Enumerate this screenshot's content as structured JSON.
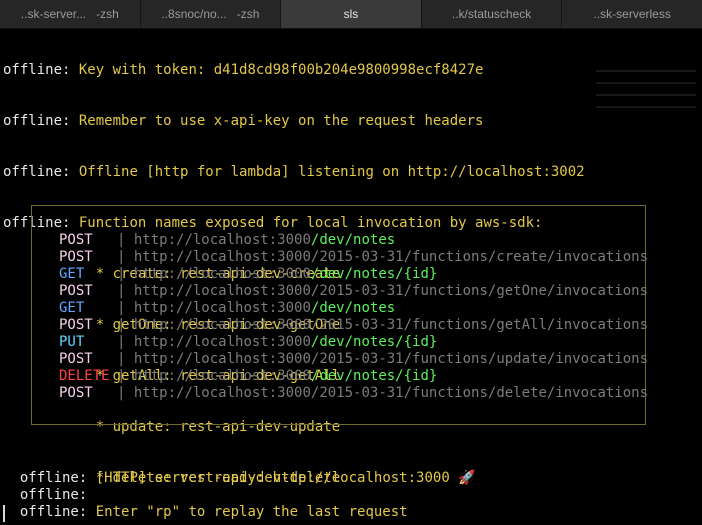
{
  "tabs": [
    {
      "main": "..sk-server...",
      "sub": "-zsh"
    },
    {
      "main": "..8snoc/no...",
      "sub": "-zsh"
    },
    {
      "main": "sls",
      "sub": ""
    },
    {
      "main": "..k/statuscheck",
      "sub": ""
    },
    {
      "main": "..sk-serverless",
      "sub": ""
    }
  ],
  "prefix": "offline:",
  "log_top": [
    "Key with token: d41d8cd98f00b204e9800998ecf8427e",
    "Remember to use x-api-key on the request headers",
    "Offline [http for lambda] listening on http://localhost:3002",
    "Function names exposed for local invocation by aws-sdk:"
  ],
  "functions": [
    "* create: rest-api-dev-create",
    "* getOne: rest-api-dev-getOne",
    "* getAll: rest-api-dev-getAll",
    "* update: rest-api-dev-update",
    "* delete: rest-api-dev-delete"
  ],
  "routes": [
    {
      "method": "POST",
      "base": "http://localhost:3000",
      "path": "/dev/notes",
      "path_style": "green"
    },
    {
      "method": "POST",
      "base": "http://localhost:3000",
      "path": "/2015-03-31/functions/create/invocations",
      "path_style": "grey"
    },
    {
      "method": "GET",
      "base": "http://localhost:3000",
      "path": "/dev/notes/{id}",
      "path_style": "green"
    },
    {
      "method": "POST",
      "base": "http://localhost:3000",
      "path": "/2015-03-31/functions/getOne/invocations",
      "path_style": "grey"
    },
    {
      "method": "GET",
      "base": "http://localhost:3000",
      "path": "/dev/notes",
      "path_style": "green"
    },
    {
      "method": "POST",
      "base": "http://localhost:3000",
      "path": "/2015-03-31/functions/getAll/invocations",
      "path_style": "grey"
    },
    {
      "method": "PUT",
      "base": "http://localhost:3000",
      "path": "/dev/notes/{id}",
      "path_style": "green"
    },
    {
      "method": "POST",
      "base": "http://localhost:3000",
      "path": "/2015-03-31/functions/update/invocations",
      "path_style": "grey"
    },
    {
      "method": "DELETE",
      "base": "http://localhost:3000",
      "path": "/dev/notes/{id}",
      "path_style": "green"
    },
    {
      "method": "POST",
      "base": "http://localhost:3000",
      "path": "/2015-03-31/functions/delete/invocations",
      "path_style": "grey"
    }
  ],
  "route_separator": "|",
  "server_ready": {
    "tag": "[HTTP]",
    "text": "server ready: http://localhost:3000",
    "emoji": "🚀"
  },
  "replay_hint": "Enter \"rp\" to replay the last request",
  "colors": {
    "POST": "#f3cfe8",
    "GET": "#62a8ff",
    "PUT": "#5fd8ff",
    "DELETE": "#ff4444"
  }
}
